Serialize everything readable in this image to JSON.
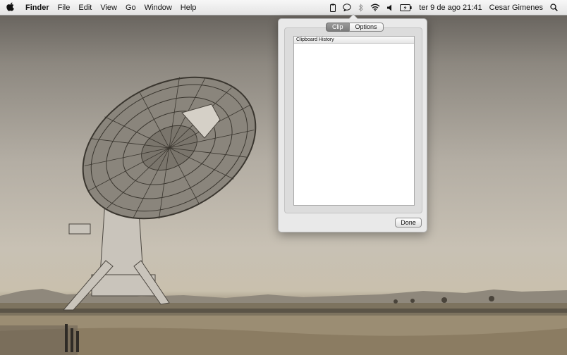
{
  "menubar": {
    "apple_icon": "apple-logo-icon",
    "app_name": "Finder",
    "menus": [
      "File",
      "Edit",
      "View",
      "Go",
      "Window",
      "Help"
    ],
    "status_icons": [
      "clipboard-icon",
      "chat-bubble-icon",
      "bluetooth-icon",
      "wifi-icon",
      "volume-icon",
      "battery-icon"
    ],
    "datetime": "ter 9 de ago  21:41",
    "user": "Cesar Gimenes",
    "spotlight_icon": "spotlight-search-icon"
  },
  "popover": {
    "tabs": [
      "Clip",
      "Options"
    ],
    "active_tab": "Clip",
    "list_header": "Clipboard History",
    "done_label": "Done"
  }
}
